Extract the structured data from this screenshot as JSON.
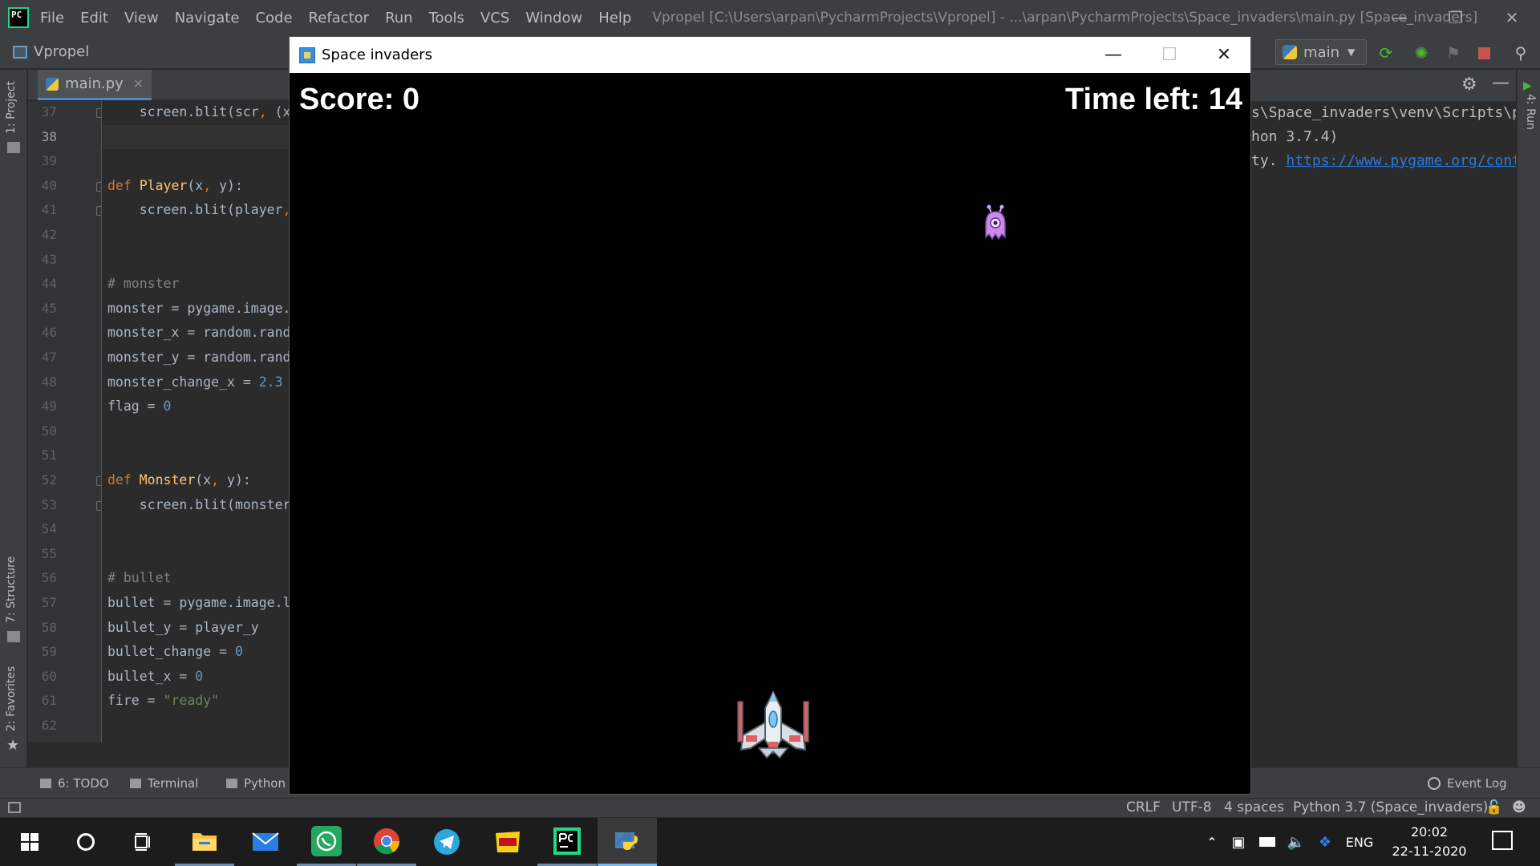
{
  "ide": {
    "title": "Vpropel [C:\\Users\\arpan\\PycharmProjects\\Vpropel] - ...\\arpan\\PycharmProjects\\Space_invaders\\main.py [Space_invaders]",
    "logo_text": "PC",
    "menu": [
      "File",
      "Edit",
      "View",
      "Navigate",
      "Code",
      "Refactor",
      "Run",
      "Tools",
      "VCS",
      "Window",
      "Help"
    ],
    "window_controls": [
      "minimize",
      "restore",
      "close"
    ]
  },
  "navbar": {
    "project": "Vpropel",
    "run_config": "main",
    "tool_icons": [
      "rerun-icon",
      "debug-icon",
      "coverage-icon",
      "stop-icon",
      "search-icon"
    ]
  },
  "left_strip": {
    "tabs": [
      "1: Project",
      "7: Structure",
      "2: Favorites"
    ]
  },
  "editor": {
    "tab": "main.py",
    "current_line": 38,
    "lines": [
      {
        "n": 37,
        "text": "    screen.blit(scr, (x"
      },
      {
        "n": 38,
        "text": ""
      },
      {
        "n": 39,
        "text": ""
      },
      {
        "n": 40,
        "text": "def Player(x, y):"
      },
      {
        "n": 41,
        "text": "    screen.blit(player,"
      },
      {
        "n": 42,
        "text": ""
      },
      {
        "n": 43,
        "text": ""
      },
      {
        "n": 44,
        "text": "# monster"
      },
      {
        "n": 45,
        "text": "monster = pygame.image."
      },
      {
        "n": 46,
        "text": "monster_x = random.rand"
      },
      {
        "n": 47,
        "text": "monster_y = random.rand"
      },
      {
        "n": 48,
        "text": "monster_change_x = 2.3"
      },
      {
        "n": 49,
        "text": "flag = 0"
      },
      {
        "n": 50,
        "text": ""
      },
      {
        "n": 51,
        "text": ""
      },
      {
        "n": 52,
        "text": "def Monster(x, y):"
      },
      {
        "n": 53,
        "text": "    screen.blit(monster"
      },
      {
        "n": 54,
        "text": ""
      },
      {
        "n": 55,
        "text": ""
      },
      {
        "n": 56,
        "text": "# bullet"
      },
      {
        "n": 57,
        "text": "bullet = pygame.image.l"
      },
      {
        "n": 58,
        "text": "bullet_y = player_y"
      },
      {
        "n": 59,
        "text": "bullet_change = 0"
      },
      {
        "n": 60,
        "text": "bullet_x = 0"
      },
      {
        "n": 61,
        "text": "fire = \"ready\""
      },
      {
        "n": 62,
        "text": ""
      }
    ]
  },
  "run_panel": {
    "tab_label": "4: Run",
    "lines": [
      "s\\Space_invaders\\venv\\Scripts\\pyt",
      "hon 3.7.4)",
      "ty. "
    ],
    "link": "https://www.pygame.org/contri"
  },
  "bottom_tools": {
    "todo": "6: TODO",
    "terminal": "Terminal",
    "python": "Python",
    "event_log": "Event Log"
  },
  "status": {
    "line_sep": "CRLF",
    "encoding": "UTF-8",
    "indent": "4 spaces",
    "interpreter": "Python 3.7 (Space_invaders)"
  },
  "game": {
    "window_title": "Space invaders",
    "score_label": "Score: 0",
    "time_label": "Time left: 14"
  },
  "taskbar": {
    "apps": [
      "start-icon",
      "cortana-icon",
      "task-view-icon",
      "file-explorer-icon",
      "mail-icon",
      "whatsapp-icon",
      "chrome-icon",
      "telegram-icon",
      "pdf-icon",
      "pycharm-icon",
      "python-icon"
    ],
    "language": "ENG",
    "time": "20:02",
    "date": "22-11-2020"
  },
  "colors": {
    "ide_bg": "#2b2b2b",
    "panel": "#3c3f41",
    "keyword": "#cc7832",
    "function": "#ffc66d",
    "number": "#6897bb",
    "string": "#6a8759",
    "comment": "#808080",
    "link": "#287bde",
    "game_bg": "#000000"
  }
}
